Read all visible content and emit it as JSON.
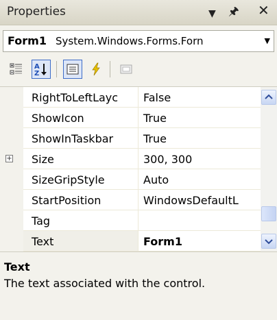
{
  "window": {
    "title": "Properties"
  },
  "object_selector": {
    "name": "Form1",
    "type": "System.Windows.Forms.Forn"
  },
  "toolbar": {
    "buttons": [
      {
        "icon": "categorized-icon",
        "active": false
      },
      {
        "icon": "alphabetical-icon",
        "active": true
      },
      {
        "icon": "properties-icon",
        "active": true
      },
      {
        "icon": "events-icon",
        "active": false
      },
      {
        "icon": "property-pages-icon",
        "active": false
      }
    ]
  },
  "properties": [
    {
      "name": "RightToLeftLayc",
      "value": "False",
      "expandable": false,
      "bold": false
    },
    {
      "name": "ShowIcon",
      "value": "True",
      "expandable": false,
      "bold": false
    },
    {
      "name": "ShowInTaskbar",
      "value": "True",
      "expandable": false,
      "bold": false
    },
    {
      "name": "Size",
      "value": "300, 300",
      "expandable": true,
      "bold": false
    },
    {
      "name": "SizeGripStyle",
      "value": "Auto",
      "expandable": false,
      "bold": false
    },
    {
      "name": "StartPosition",
      "value": "WindowsDefaultL",
      "expandable": false,
      "bold": false
    },
    {
      "name": "Tag",
      "value": "",
      "expandable": false,
      "bold": false
    },
    {
      "name": "Text",
      "value": "Form1",
      "expandable": false,
      "bold": true
    }
  ],
  "selected_property": "Text",
  "description": {
    "title": "Text",
    "text": "The text associated with the control."
  },
  "colors": {
    "panel_bg": "#f3f2ec",
    "selection_blue": "#3d6cc8",
    "scrollbar_blue": "#c7d6f3"
  }
}
